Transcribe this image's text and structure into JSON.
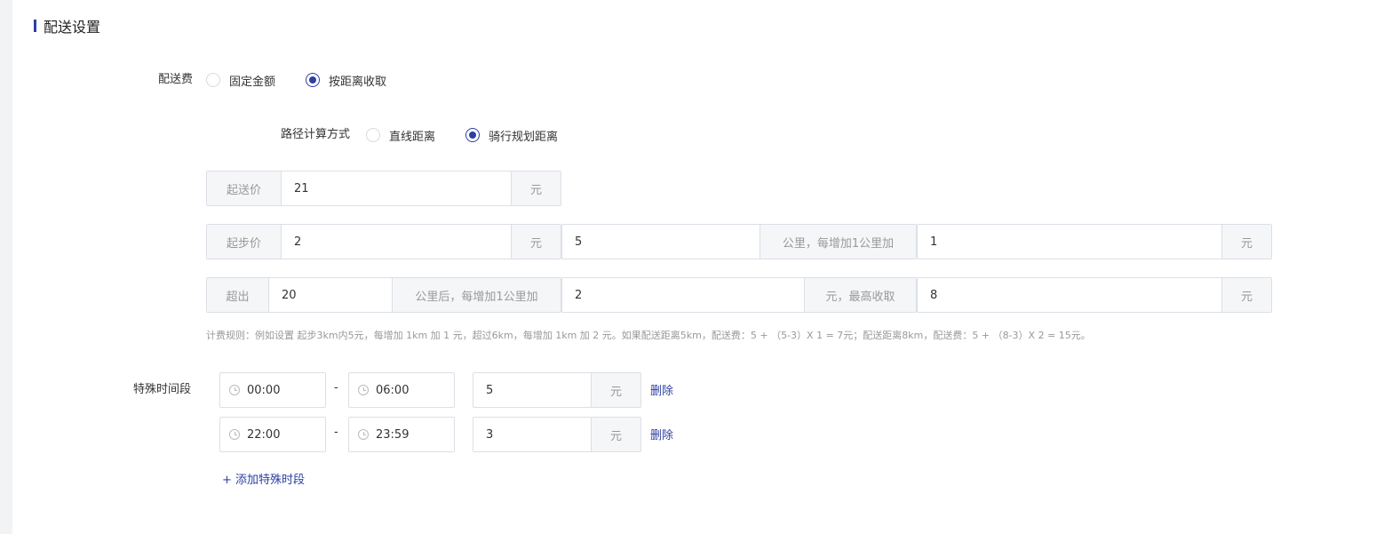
{
  "section": {
    "title": "配送设置"
  },
  "fee": {
    "label": "配送费",
    "options": [
      {
        "label": "固定金额",
        "checked": false
      },
      {
        "label": "按距离收取",
        "checked": true
      }
    ]
  },
  "route": {
    "label": "路径计算方式",
    "options": [
      {
        "label": "直线距离",
        "checked": false
      },
      {
        "label": "骑行规划距离",
        "checked": true
      }
    ]
  },
  "min_order": {
    "prefix": "起送价",
    "value": "21",
    "suffix": "元"
  },
  "start_price": {
    "prefix": "起步价",
    "value": "2",
    "suffix": "元",
    "km_value": "5",
    "km_suffix": "公里，每增加1公里加",
    "add_value": "1",
    "add_suffix": "元"
  },
  "exceed": {
    "prefix": "超出",
    "km_value": "20",
    "km_suffix": "公里后，每增加1公里加",
    "add_value": "2",
    "add_suffix": "元，最高收取",
    "max_value": "8",
    "max_suffix": "元"
  },
  "rule_hint": "计费规则：例如设置 起步3km内5元，每增加 1km 加 1 元，超过6km，每增加 1km 加 2 元。如果配送距离5km，配送费：5 + （5-3）X 1 = 7元；配送距离8km，配送费：5 + （8-3）X 2 = 15元。",
  "special": {
    "label": "特殊时间段",
    "rows": [
      {
        "start": "00:00",
        "end": "06:00",
        "price": "5",
        "unit": "元",
        "delete": "删除"
      },
      {
        "start": "22:00",
        "end": "23:59",
        "price": "3",
        "unit": "元",
        "delete": "删除"
      }
    ],
    "separator": "-",
    "add_label": "+ 添加特殊时段"
  },
  "colors": {
    "accent": "#2d3fa3",
    "border": "#dcdfe6",
    "addon_bg": "#f5f6f8"
  }
}
